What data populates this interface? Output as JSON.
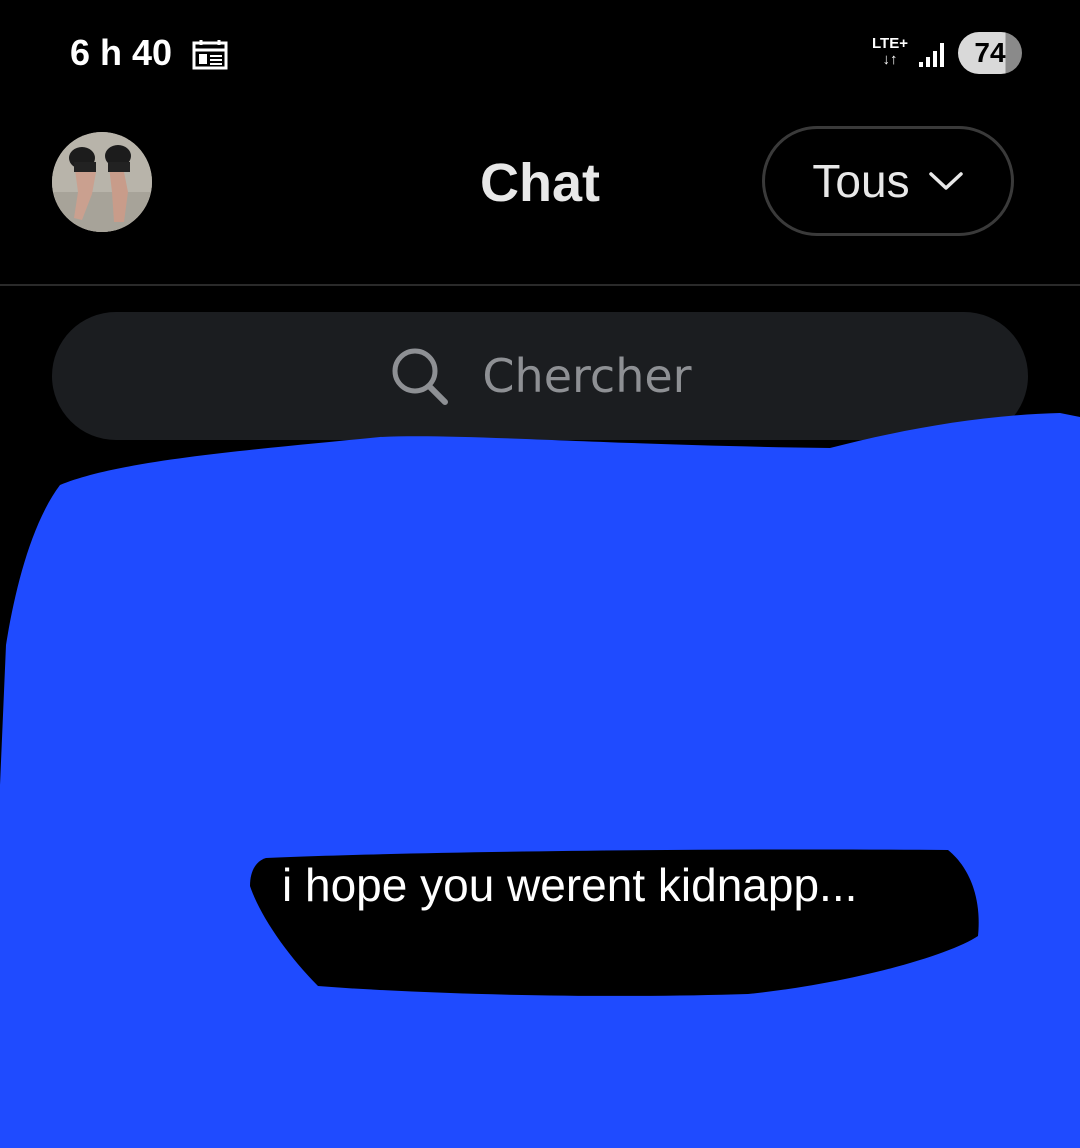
{
  "status_bar": {
    "time": "6 h 40",
    "network_line1": "LTE+",
    "network_line2": "↓↑",
    "battery": "74",
    "battery_level": 0.74
  },
  "header": {
    "title": "Chat",
    "filter_label": "Tous"
  },
  "search": {
    "placeholder": "Chercher"
  },
  "conversation_preview": {
    "text": "i hope you werent kidnapp..."
  },
  "colors": {
    "background": "#000000",
    "redaction_blue": "#1f4bff",
    "search_bg": "#1b1d20"
  },
  "icons": [
    "calendar-icon",
    "signal-icon",
    "chevron-down-icon",
    "search-icon"
  ]
}
